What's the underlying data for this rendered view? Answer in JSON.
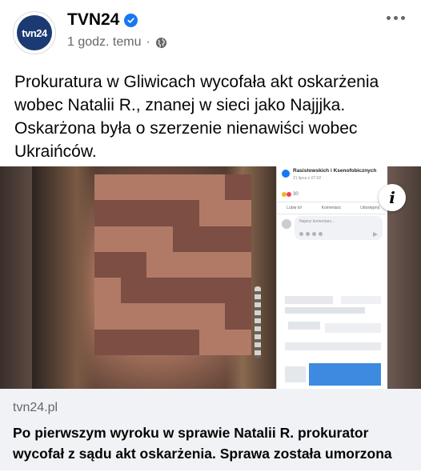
{
  "post": {
    "page_name": "TVN24",
    "avatar_text": "tvn24",
    "timestamp": "1 godz. temu",
    "separator": "·",
    "text": "Prokuratura w Gliwicach wycofała akt oskarżenia wobec Natalii R., znanej w sieci jako Najjjka. Oskarżona była o szerzenie nienawiści wobec Ukraińców."
  },
  "link_preview": {
    "domain": "tvn24.pl",
    "headline": "Po pierwszym wyroku w sprawie Natalii R. prokurator wycofał z sądu akt oskarżenia. Sprawa została umorzona",
    "info_label": "i",
    "screenshot": {
      "group_title": "Rasistowskich i Ksenofobicznych",
      "date": "21 lipca o 07:02 · ",
      "reaction_count": "30",
      "like_label": "Lubię to!",
      "comment_label": "Komentarz",
      "share_label": "Udostępnij",
      "comment_placeholder": "Napisz komentarz..."
    }
  },
  "colors": {
    "verified": "#1877f2",
    "secondary_text": "#65676b",
    "preview_background": "#f0f2f5"
  },
  "icons": [
    "verified-badge-icon",
    "globe-icon",
    "more-options-icon",
    "info-icon"
  ]
}
